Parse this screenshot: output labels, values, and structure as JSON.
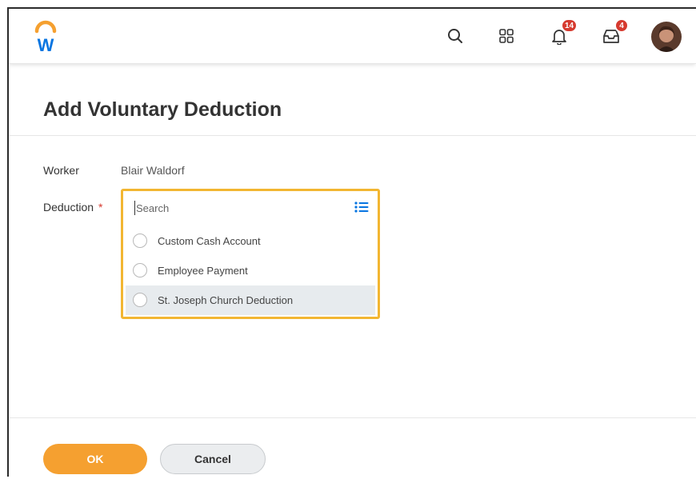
{
  "header": {
    "logo_letter": "W",
    "notifications_count": "14",
    "inbox_count": "4",
    "icons": [
      "search-icon",
      "apps-grid-icon",
      "bell-icon",
      "inbox-icon",
      "avatar"
    ],
    "colors": {
      "logo_blue": "#0875e1",
      "logo_orange": "#f5a030",
      "badge_red": "#d63a2f"
    }
  },
  "page": {
    "title": "Add Voluntary Deduction"
  },
  "form": {
    "worker_label": "Worker",
    "worker_value": "Blair Waldorf",
    "deduction_label": "Deduction",
    "required_mark": "*",
    "search": {
      "placeholder": "Search",
      "value": ""
    },
    "options": [
      {
        "label": "Custom Cash Account",
        "highlighted": false
      },
      {
        "label": "Employee Payment",
        "highlighted": false
      },
      {
        "label": "St. Joseph Church Deduction",
        "highlighted": true
      }
    ],
    "focus_color": "#f2b632"
  },
  "footer": {
    "ok_label": "OK",
    "cancel_label": "Cancel",
    "ok_color": "#f5a030"
  }
}
